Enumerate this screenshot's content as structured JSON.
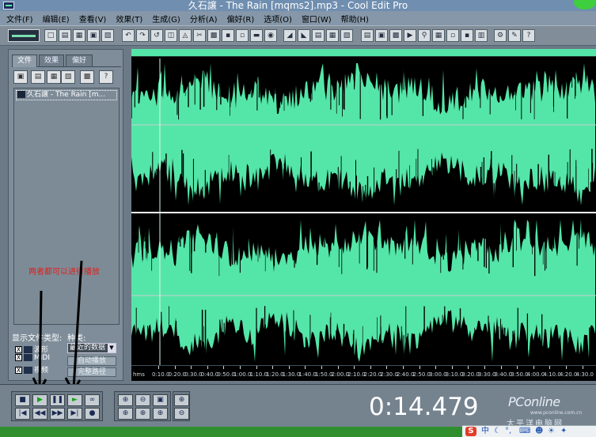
{
  "window": {
    "title": "久石譲 - The Rain [mqms2].mp3 - Cool Edit Pro"
  },
  "menu": [
    "文件(F)",
    "编辑(E)",
    "查看(V)",
    "效果(T)",
    "生成(G)",
    "分析(A)",
    "偏好(R)",
    "选项(O)",
    "窗口(W)",
    "帮助(H)"
  ],
  "left_panel": {
    "tabs": [
      "文件",
      "效果",
      "偏好"
    ],
    "files": [
      "久石譲 - The Rain [m..."
    ],
    "show_types_label": "显示文件类型:",
    "sort_label": "种类:",
    "types": [
      {
        "label": "波形",
        "checked": "X"
      },
      {
        "label": "MIDI",
        "checked": "X"
      },
      {
        "label": "视频",
        "checked": "X"
      }
    ],
    "sort_value": "最近的数据",
    "auto_play_label": "自动播放",
    "full_path_label": "完整路径"
  },
  "annotation": "两者都可以进行播放",
  "ruler": {
    "unit": "hms",
    "ticks": [
      "0:10.0",
      "0:20.0",
      "0:30.0",
      "0:40.0",
      "0:50.0",
      "1:00.0",
      "1:10.0",
      "1:20.0",
      "1:30.0",
      "1:40.0",
      "1:50.0",
      "2:00.0",
      "2:10.0",
      "2:20.0",
      "2:30.0",
      "2:40.0",
      "2:50.0",
      "3:00.0",
      "3:10.0",
      "3:20.0",
      "3:30.0",
      "3:40.0",
      "3:50.0",
      "4:00.0",
      "4:10.0",
      "4:20.0",
      "4:30.0"
    ]
  },
  "transport": {
    "time": "0:14.479"
  },
  "watermark": {
    "title": "PConline",
    "sub": "www.pconline.com.cn",
    "cn": "太平洋电脑网"
  },
  "tray": {
    "ime": "S",
    "lang": "中"
  },
  "colors": {
    "waveform": "#54e6a8",
    "background": "#000000",
    "annotation": "#e0201a"
  }
}
